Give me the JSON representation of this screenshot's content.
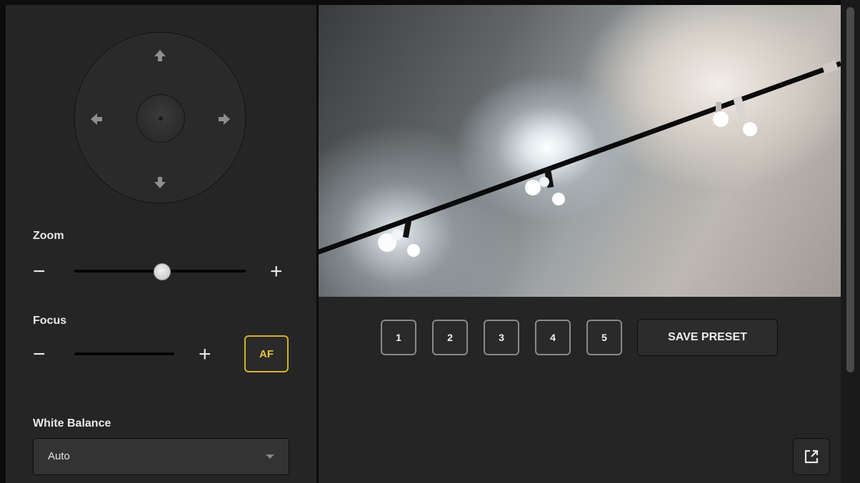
{
  "ptz": {
    "controls": [
      "up",
      "down",
      "left",
      "right",
      "center"
    ]
  },
  "zoom": {
    "label": "Zoom",
    "minus": "−",
    "plus": "+",
    "value": 0.51
  },
  "focus": {
    "label": "Focus",
    "minus": "−",
    "plus": "+",
    "af_label": "AF"
  },
  "white_balance": {
    "label": "White Balance",
    "value": "Auto"
  },
  "presets": {
    "items": [
      "1",
      "2",
      "3",
      "4",
      "5"
    ],
    "save_label": "SAVE PRESET"
  },
  "icons": {
    "popout": "external-link-icon"
  },
  "colors": {
    "accent": "#d4b22c",
    "background": "#252525"
  }
}
